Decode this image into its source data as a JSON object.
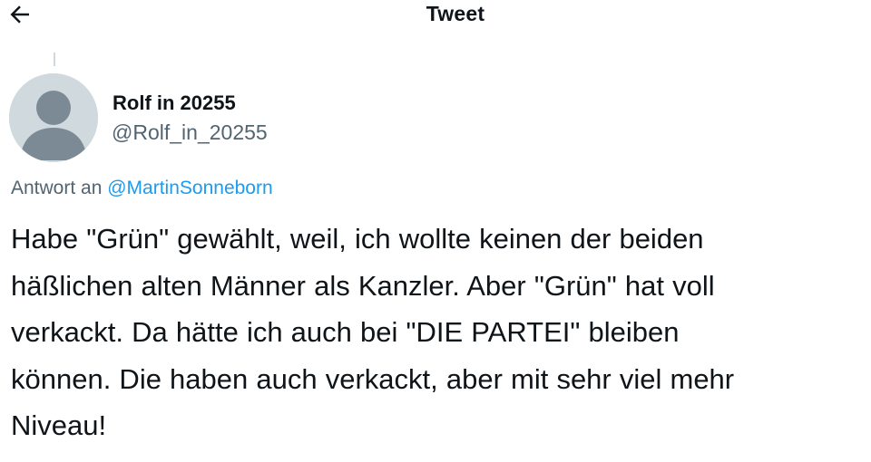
{
  "header": {
    "title": "Tweet",
    "back_icon": "arrow-left-icon"
  },
  "tweet": {
    "author": {
      "display_name": "Rolf in 20255",
      "username": "@Rolf_in_20255",
      "avatar_icon": "default-avatar-icon"
    },
    "reply_context": {
      "prefix": "Antwort an",
      "mention": "@MartinSonneborn"
    },
    "text_lines": [
      "Habe \"Grün\" gewählt, weil, ich wollte keinen der beiden",
      "häßlichen alten Männer als Kanzler. Aber \"Grün\" hat voll",
      "verkackt. Da hätte ich auch bei \"DIE PARTEI\" bleiben",
      "können. Die haben auch verkackt, aber mit sehr viel mehr",
      "Niveau!"
    ]
  },
  "colors": {
    "text_primary": "#0f1419",
    "text_secondary": "#536471",
    "link": "#1d9bf0",
    "avatar_bg": "#cfd9de",
    "avatar_fg": "#7b8a95"
  }
}
